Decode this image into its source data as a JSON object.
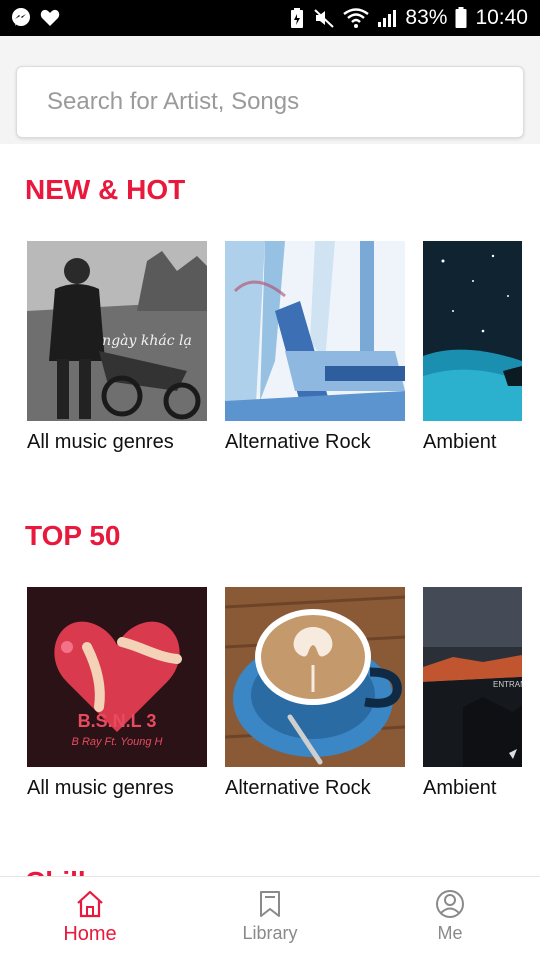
{
  "status_bar": {
    "left_icons": [
      "messenger-icon",
      "heart-icon"
    ],
    "right_icons": [
      "battery-saver-icon",
      "mute-icon",
      "wifi-icon",
      "signal-icon"
    ],
    "battery_percent": "83%",
    "time": "10:40"
  },
  "search": {
    "placeholder": "Search for Artist, Songs",
    "value": ""
  },
  "sections": [
    {
      "title": "NEW & HOT",
      "items": [
        {
          "label": "All music genres",
          "cover_text": "ngày khác lạ"
        },
        {
          "label": "Alternative Rock"
        },
        {
          "label": "Ambient"
        }
      ]
    },
    {
      "title": "TOP 50",
      "items": [
        {
          "label": "All music genres",
          "cover_text": "B.S.N.L 3",
          "cover_subtext": "B Ray Ft. Young H"
        },
        {
          "label": "Alternative Rock"
        },
        {
          "label": "Ambient",
          "cover_text": "ENTRAN"
        }
      ]
    }
  ],
  "peek_section_title": "Chill",
  "bottom_nav": [
    {
      "label": "Home",
      "icon": "home-icon",
      "active": true
    },
    {
      "label": "Library",
      "icon": "bookmark-icon",
      "active": false
    },
    {
      "label": "Me",
      "icon": "profile-icon",
      "active": false
    }
  ],
  "colors": {
    "accent": "#e8193c",
    "inactive": "#8a8a8a",
    "status_bar": "#000000"
  }
}
